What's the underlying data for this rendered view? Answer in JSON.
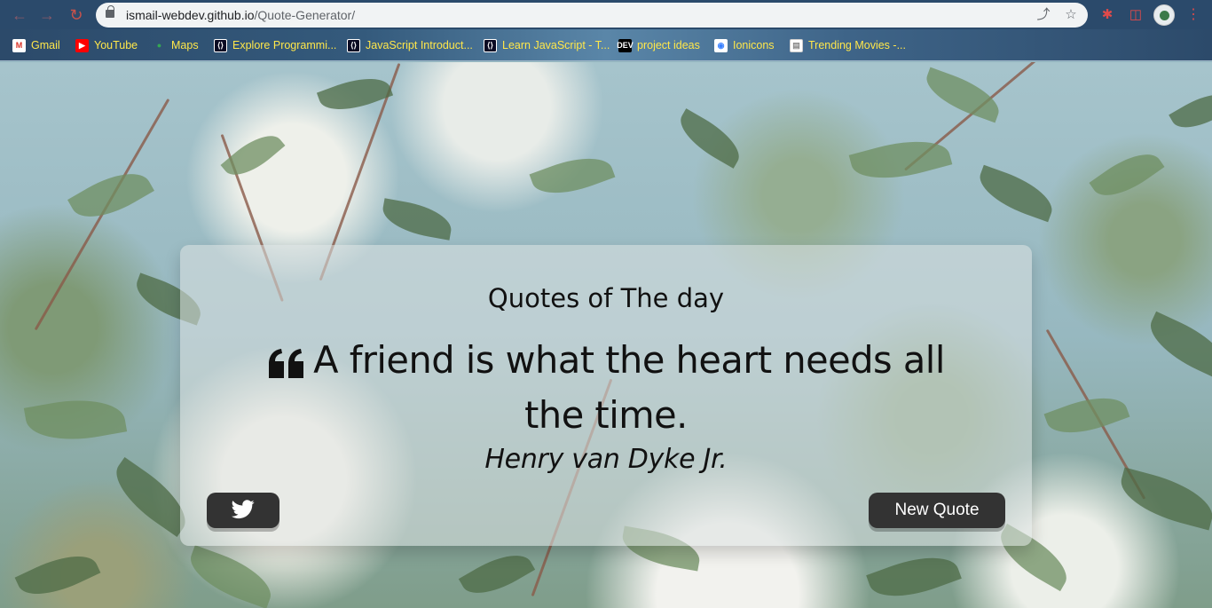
{
  "browser": {
    "url_host": "ismail-webdev.github.io",
    "url_path": "/Quote-Generator/"
  },
  "bookmarks": [
    {
      "label": "Gmail",
      "icon": "gmail-icon",
      "glyph": "M"
    },
    {
      "label": "YouTube",
      "icon": "youtube-icon",
      "glyph": "▶"
    },
    {
      "label": "Maps",
      "icon": "maps-pin-icon",
      "glyph": "●"
    },
    {
      "label": "Explore Programmi...",
      "icon": "freecodecamp-icon",
      "glyph": "⟨⟩"
    },
    {
      "label": "JavaScript Introduct...",
      "icon": "freecodecamp-icon",
      "glyph": "⟨⟩"
    },
    {
      "label": "Learn JavaScript - T...",
      "icon": "freecodecamp-icon",
      "glyph": "⟨⟩"
    },
    {
      "label": "project ideas",
      "icon": "dev-icon",
      "glyph": "DEV"
    },
    {
      "label": "Ionicons",
      "icon": "ionicons-icon",
      "glyph": "◉"
    },
    {
      "label": "Trending Movies -...",
      "icon": "page-icon",
      "glyph": "▤"
    }
  ],
  "card": {
    "title": "Quotes of The day",
    "quote": "A friend is what the heart needs all the time.",
    "author": "Henry van Dyke Jr.",
    "new_quote_label": "New Quote"
  }
}
